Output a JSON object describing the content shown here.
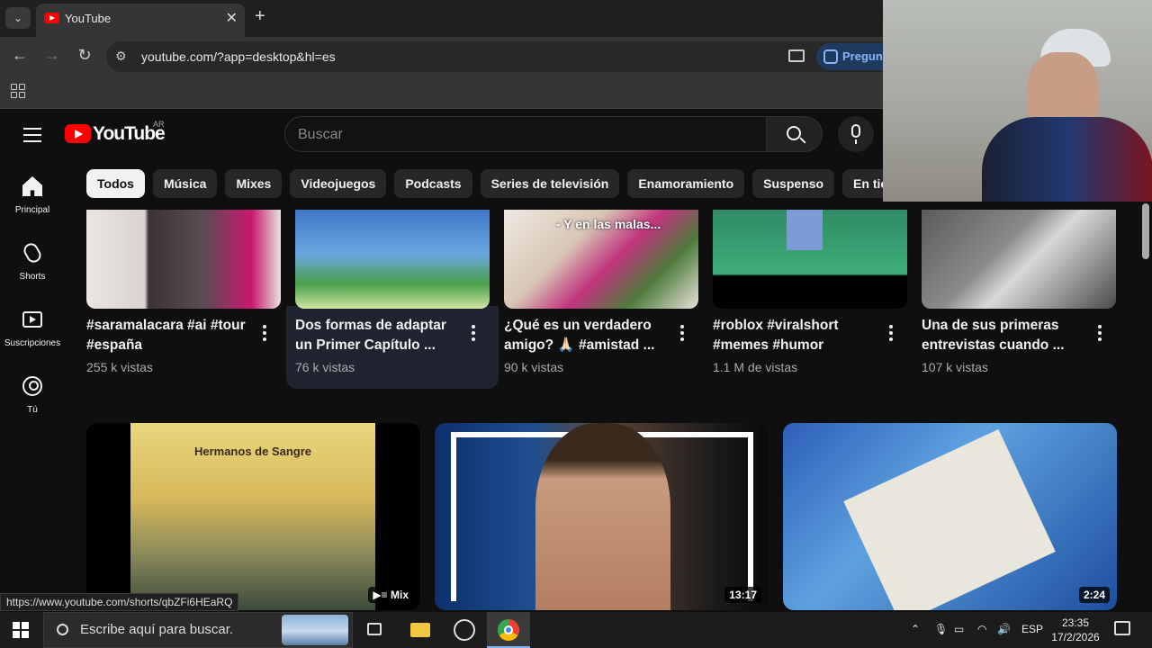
{
  "browser": {
    "tab_title": "YouTube",
    "url": "youtube.com/?app=desktop&hl=es",
    "ask_label": "Pregunt"
  },
  "masthead": {
    "wordmark": "YouTube",
    "country": "AR",
    "search_placeholder": "Buscar"
  },
  "chips": [
    "Todos",
    "Música",
    "Mixes",
    "Videojuegos",
    "Podcasts",
    "Series de televisión",
    "Enamoramiento",
    "Suspenso",
    "En tiem"
  ],
  "sidebar": [
    {
      "label": "Principal",
      "icon": "home-icon"
    },
    {
      "label": "Shorts",
      "icon": "shorts-icon"
    },
    {
      "label": "Suscripciones",
      "icon": "subscriptions-icon"
    },
    {
      "label": "Tú",
      "icon": "you-icon"
    }
  ],
  "shorts": [
    {
      "title": "#saramalacara #ai #tour #españa",
      "views": "255 k vistas"
    },
    {
      "title": "Dos formas de adaptar un Primer Capítulo ...",
      "views": "76 k vistas",
      "overlay": ""
    },
    {
      "title": "¿Qué es un verdadero amigo? 🙏🏻 #amistad ...",
      "views": "90 k vistas",
      "overlay": "- Y en las malas..."
    },
    {
      "title": "#roblox #viralshort #memes #humor",
      "views": "1.1 M de vistas"
    },
    {
      "title": "Una de sus primeras entrevistas cuando ...",
      "views": "107 k vistas"
    }
  ],
  "videos": [
    {
      "badge": "Mix",
      "thumb_text": "Hermanos de Sangre"
    },
    {
      "badge": "13:17"
    },
    {
      "badge": "2:24"
    }
  ],
  "status_url": "https://www.youtube.com/shorts/qbZFi6HEaRQ",
  "taskbar": {
    "search_placeholder": "Escribe aquí para buscar.",
    "lang": "ESP",
    "time": "23:35",
    "date": "17/2/2026"
  }
}
